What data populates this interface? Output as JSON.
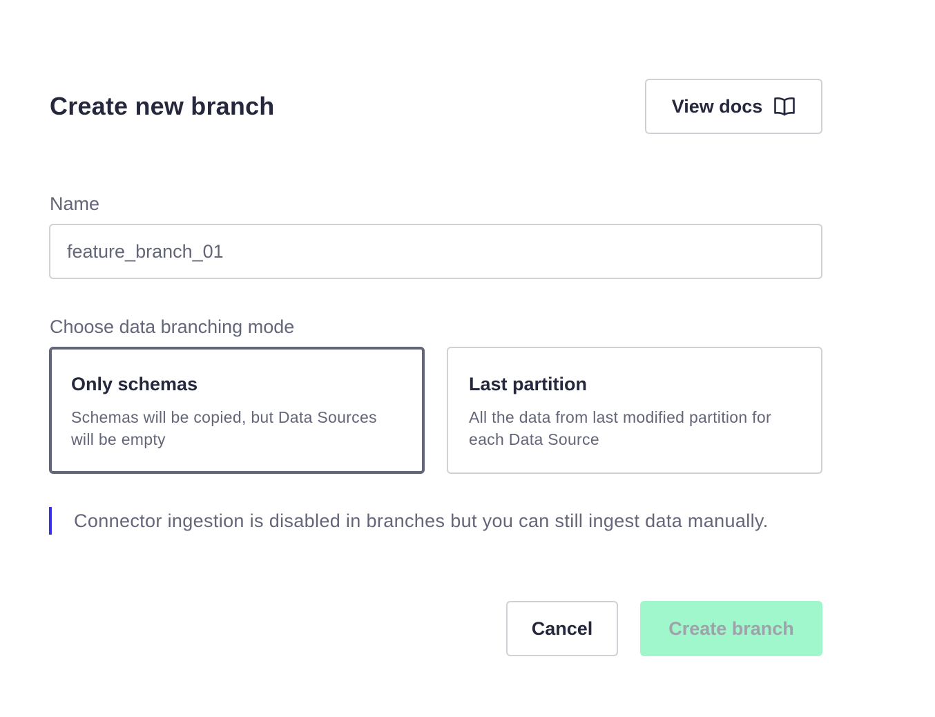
{
  "dialog": {
    "title": "Create new branch",
    "docs_button": {
      "label": "View docs",
      "icon": "book-open-icon"
    }
  },
  "name_field": {
    "label": "Name",
    "value": "feature_branch_01"
  },
  "mode": {
    "label": "Choose data branching mode",
    "options": [
      {
        "title": "Only schemas",
        "description": "Schemas will be copied, but Data Sources will be empty",
        "selected": true
      },
      {
        "title": "Last partition",
        "description": "All the data from last modified partition for each Data Source",
        "selected": false
      }
    ]
  },
  "notice": {
    "text": "Connector ingestion is disabled in branches but you can still ingest data manually.",
    "accent_color": "#3a32e6"
  },
  "actions": {
    "cancel_label": "Cancel",
    "create_label": "Create branch",
    "create_color": "#9ff7cb"
  }
}
